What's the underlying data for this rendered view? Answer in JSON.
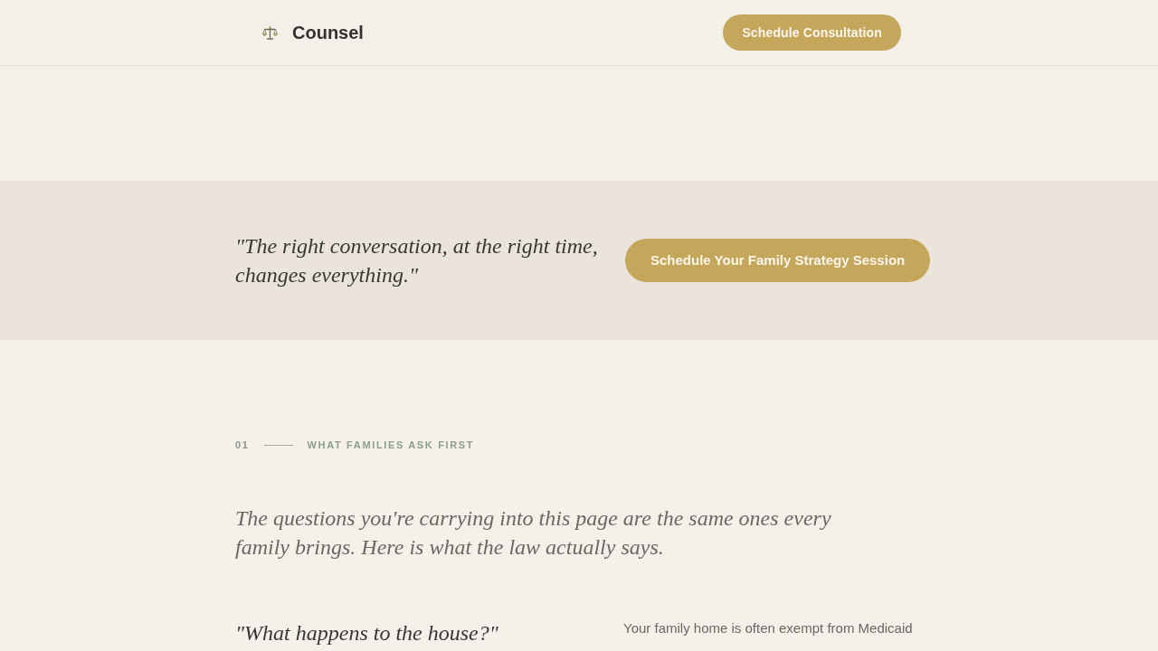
{
  "header": {
    "brand": "Counsel",
    "button": "Schedule Consultation"
  },
  "cta_band": {
    "quote": "\"The right conversation, at the right time, changes everything.\"",
    "button": "Schedule Your Family Strategy Session"
  },
  "section": {
    "number": "01",
    "eyebrow": "WHAT FAMILIES ASK FIRST",
    "intro": "The questions you're carrying into this page are the same ones every family brings. Here is what the law actually says.",
    "faqs": [
      {
        "question": "\"What happens to the house?\"",
        "answer": "Your family home is often exempt from Medicaid"
      }
    ]
  }
}
